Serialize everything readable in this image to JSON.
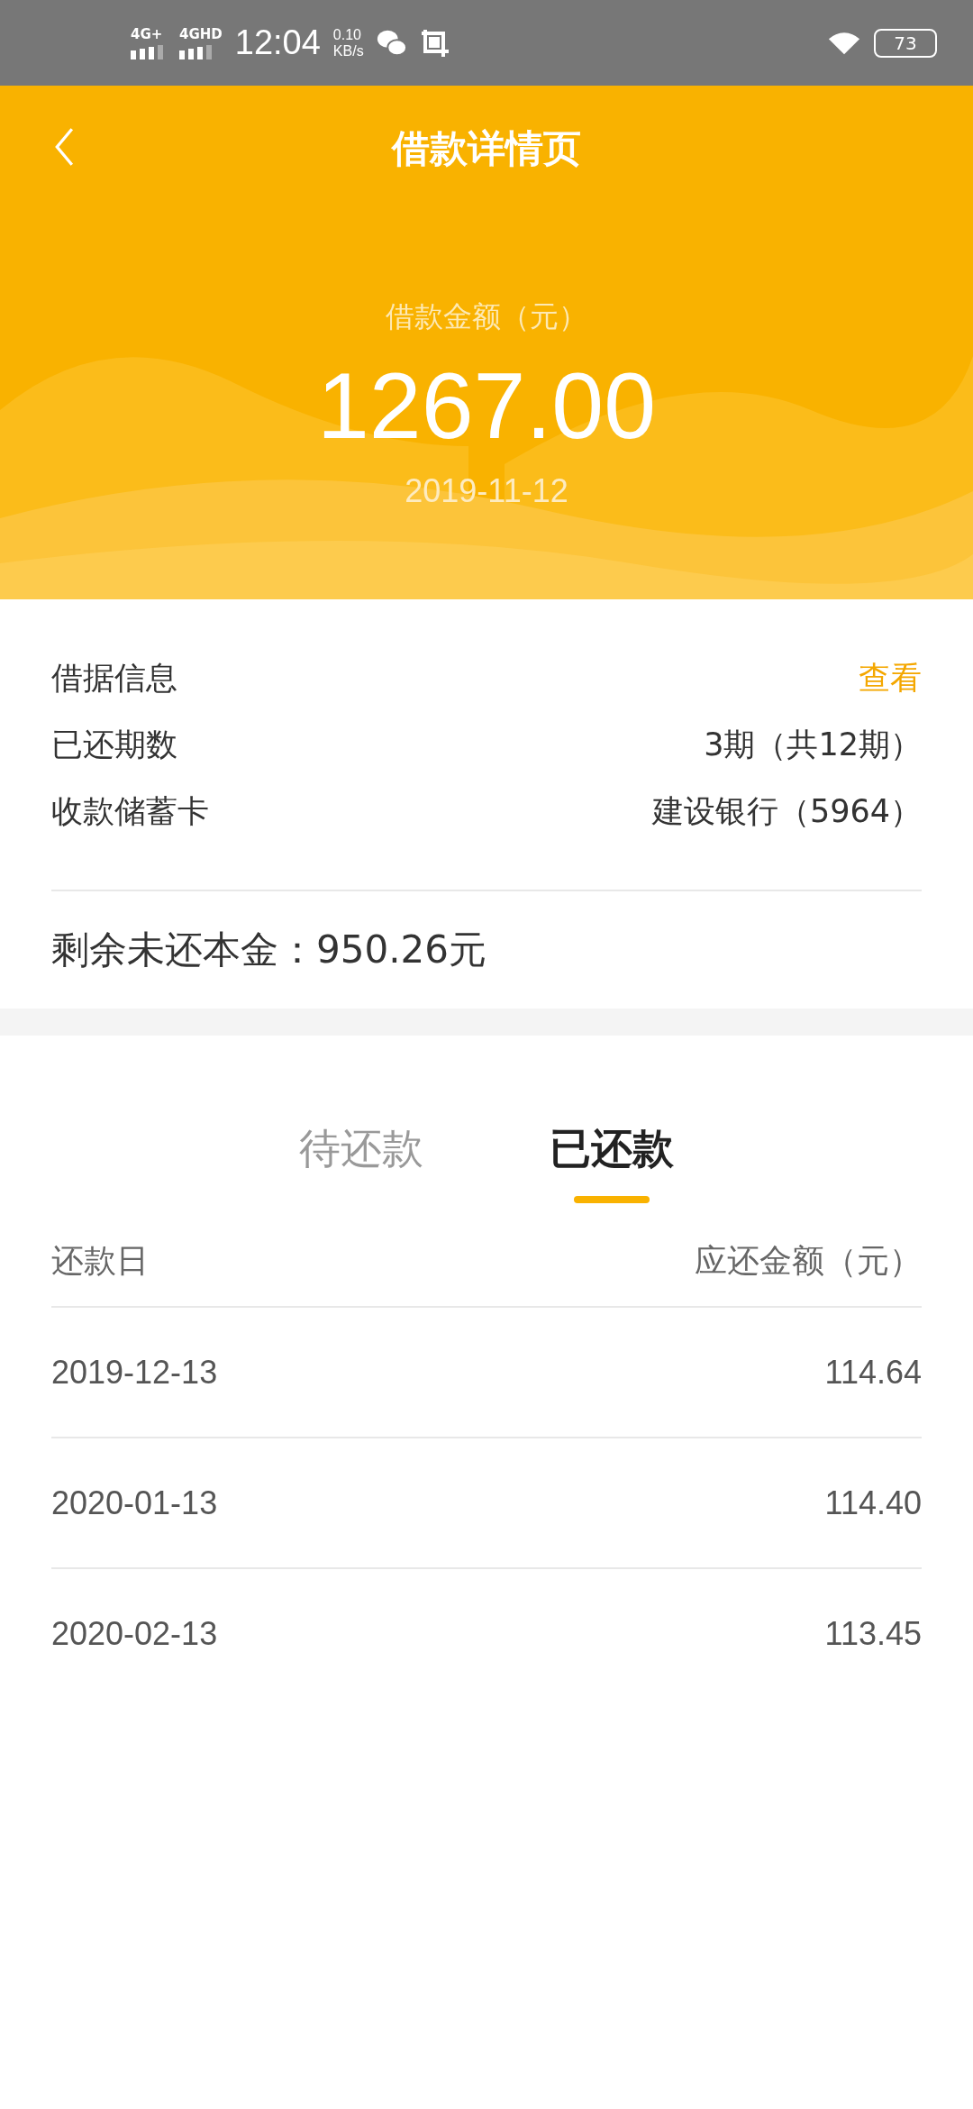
{
  "status_bar": {
    "network_1": "4G+",
    "network_2": "4GHD",
    "time": "12:04",
    "speed": "0.10",
    "speed_unit": "KB/s",
    "battery": "73"
  },
  "header": {
    "title": "借款详情页",
    "amount_label": "借款金额（元）",
    "amount": "1267.00",
    "date": "2019-11-12"
  },
  "info": {
    "rows": [
      {
        "label": "借据信息",
        "value": "查看",
        "kind": "link"
      },
      {
        "label": "已还期数",
        "value": "3期（共12期）",
        "kind": "text"
      },
      {
        "label": "收款储蓄卡",
        "value": "建设银行（5964）",
        "kind": "text"
      }
    ],
    "remaining": "剩余未还本金：950.26元"
  },
  "tabs": [
    {
      "label": "待还款",
      "selected": false
    },
    {
      "label": "已还款",
      "selected": true
    }
  ],
  "table": {
    "columns": [
      "还款日",
      "应还金额（元）"
    ],
    "rows": [
      [
        "2019-12-13",
        "114.64"
      ],
      [
        "2020-01-13",
        "114.40"
      ],
      [
        "2020-02-13",
        "113.45"
      ]
    ]
  }
}
